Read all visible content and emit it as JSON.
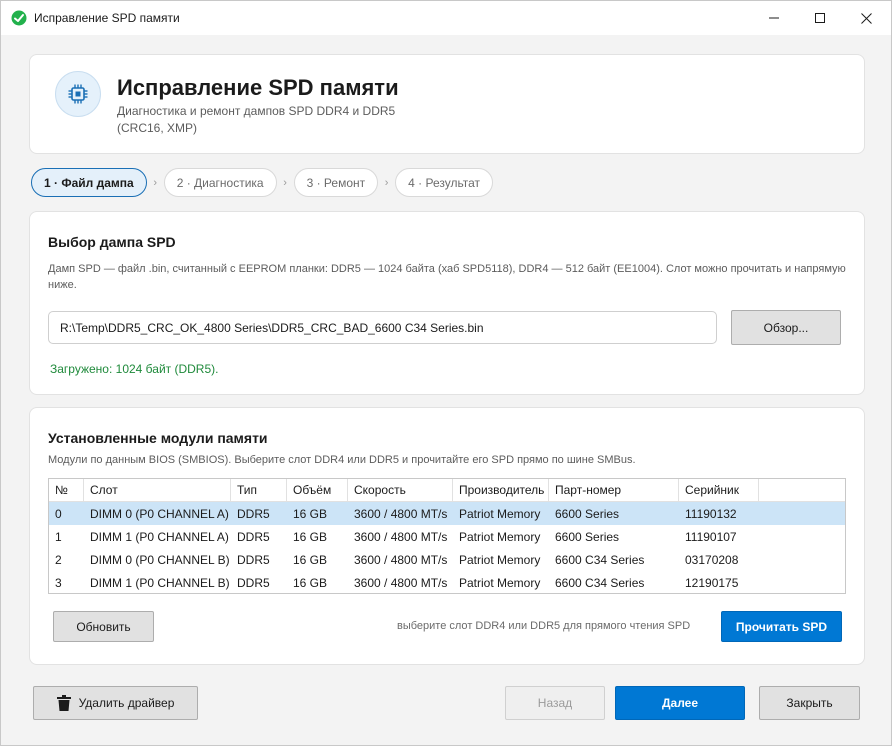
{
  "window": {
    "title": "Исправление SPD памяти",
    "accent_color": "#0078d4"
  },
  "header": {
    "title": "Исправление SPD памяти",
    "subtitle": "Диагностика и ремонт дампов SPD DDR4 и DDR5 (CRC16, XMP)",
    "icon": "chip-icon"
  },
  "steps": [
    {
      "label": "1 · Файл дампа",
      "active": true
    },
    {
      "label": "2 · Диагностика",
      "active": false
    },
    {
      "label": "3 · Ремонт",
      "active": false
    },
    {
      "label": "4 · Результат",
      "active": false
    }
  ],
  "dump": {
    "title": "Выбор дампа SPD",
    "description": "Дамп SPD — файл .bin, считанный с EEPROM планки: DDR5 — 1024 байта (хаб SPD5118), DDR4 — 512 байт (EE1004). Слот можно прочитать и напрямую ниже.",
    "path_value": "R:\\Temp\\DDR5_CRC_OK_4800 Series\\DDR5_CRC_BAD_6600 C34 Series.bin",
    "browse_label": "Обзор...",
    "status": "Загружено: 1024 байт (DDR5).",
    "status_color": "#1f8a3b"
  },
  "modules": {
    "title": "Установленные модули памяти",
    "description": "Модули по данным BIOS (SMBIOS). Выберите слот DDR4 или DDR5 и прочитайте его SPD прямо по шине SMBus.",
    "columns": [
      "№",
      "Слот",
      "Тип",
      "Объём",
      "Скорость",
      "Производитель",
      "Парт-номер",
      "Серийник"
    ],
    "rows": [
      [
        "0",
        "DIMM 0 (P0 CHANNEL A)",
        "DDR5",
        "16 GB",
        "3600 / 4800 MT/s",
        "Patriot Memory",
        "6600 Series",
        "11190132"
      ],
      [
        "1",
        "DIMM 1 (P0 CHANNEL A)",
        "DDR5",
        "16 GB",
        "3600 / 4800 MT/s",
        "Patriot Memory",
        "6600 Series",
        "11190107"
      ],
      [
        "2",
        "DIMM 0 (P0 CHANNEL B)",
        "DDR5",
        "16 GB",
        "3600 / 4800 MT/s",
        "Patriot Memory",
        "6600 C34 Series",
        "03170208"
      ],
      [
        "3",
        "DIMM 1 (P0 CHANNEL B)",
        "DDR5",
        "16 GB",
        "3600 / 4800 MT/s",
        "Patriot Memory",
        "6600 C34 Series",
        "12190175"
      ]
    ],
    "selected_row": 0,
    "refresh_label": "Обновить",
    "hint": "выберите слот DDR4 или DDR5 для прямого чтения SPD",
    "read_label": "Прочитать SPD"
  },
  "footer": {
    "remove_driver_label": "Удалить драйвер",
    "back_label": "Назад",
    "next_label": "Далее",
    "close_label": "Закрыть"
  }
}
